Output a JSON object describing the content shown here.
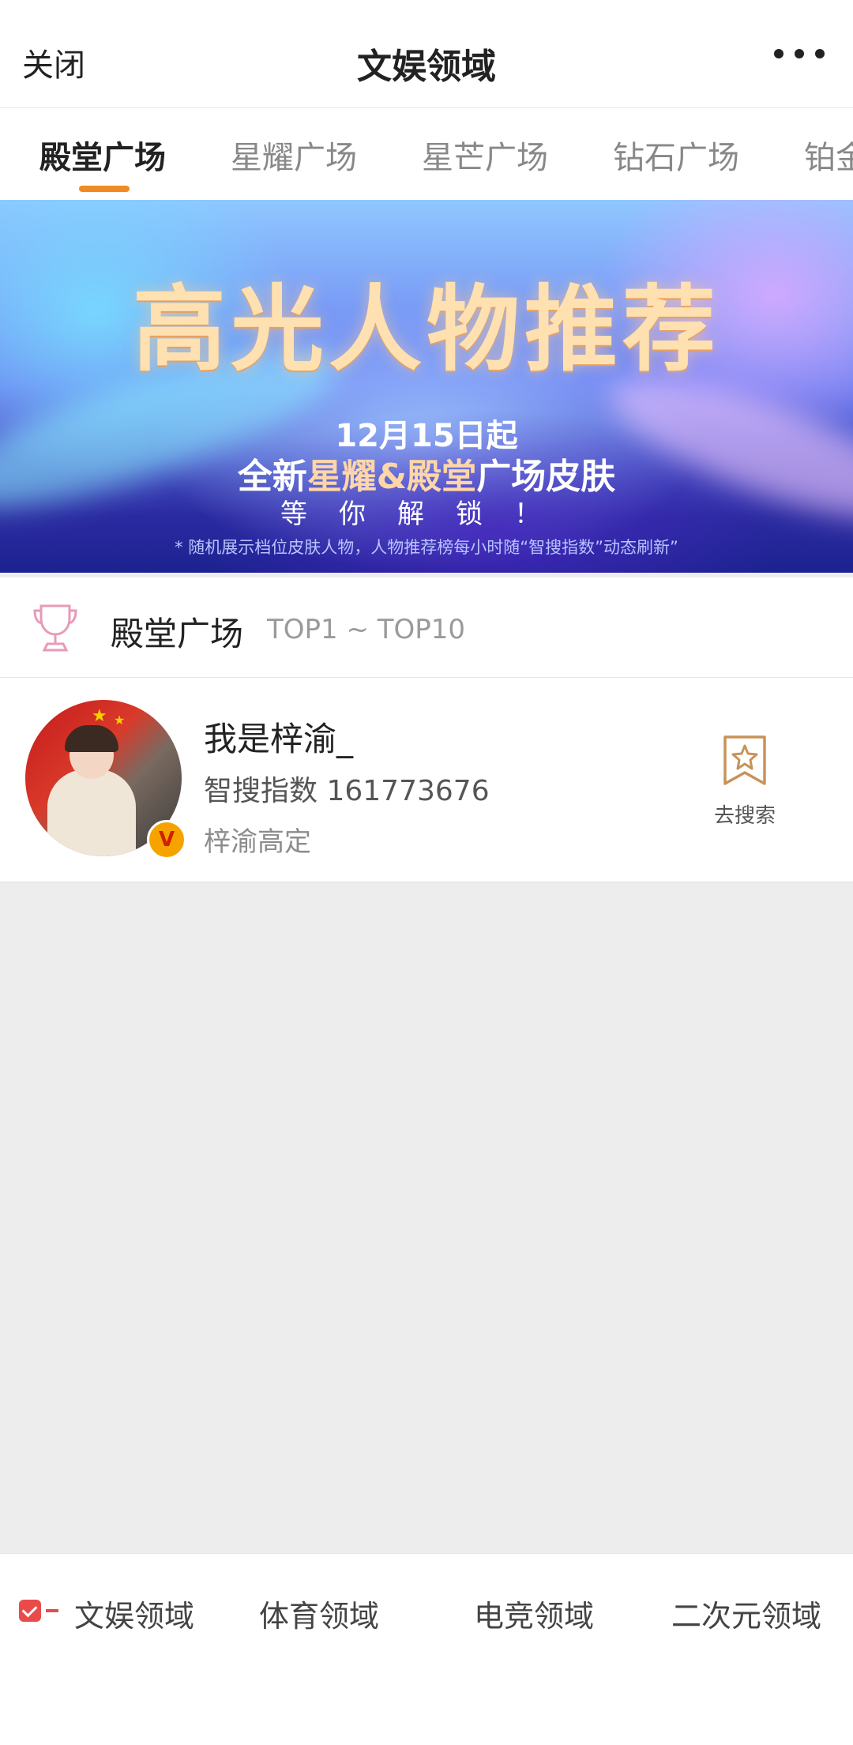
{
  "header": {
    "close_label": "关闭",
    "title": "文娱领域",
    "more_icon": "more-dots-icon"
  },
  "tabs": [
    {
      "label": "殿堂广场",
      "active": true
    },
    {
      "label": "星耀广场",
      "active": false
    },
    {
      "label": "星芒广场",
      "active": false
    },
    {
      "label": "钻石广场",
      "active": false
    },
    {
      "label": "铂金",
      "active": false
    }
  ],
  "banner": {
    "headline": "高光人物推荐",
    "date": "12月15日起",
    "skin_prefix": "全新",
    "skin_highlight": "星耀&殿堂",
    "skin_suffix": "广场皮肤",
    "unlock": "等你解锁！",
    "note": "* 随机展示档位皮肤人物，人物推荐榜每小时随“智搜指数”动态刷新”"
  },
  "section": {
    "title": "殿堂广场",
    "range": "TOP1 ~ TOP10",
    "icon": "trophy-icon"
  },
  "entries": [
    {
      "name": "我是梓渝_",
      "index_label": "智搜指数",
      "index_value": "161773676",
      "subtitle": "梓渝高定",
      "verified_badge": "V",
      "action_label": "去搜索",
      "action_icon": "bookmark-star-icon"
    }
  ],
  "bottom_nav": {
    "items": [
      "文娱领域",
      "体育领域",
      "电竞领域",
      "二次元领域"
    ],
    "active_index": 0
  },
  "colors": {
    "accent": "#f08a24",
    "check": "#e94b4b",
    "background": "#ededed"
  }
}
